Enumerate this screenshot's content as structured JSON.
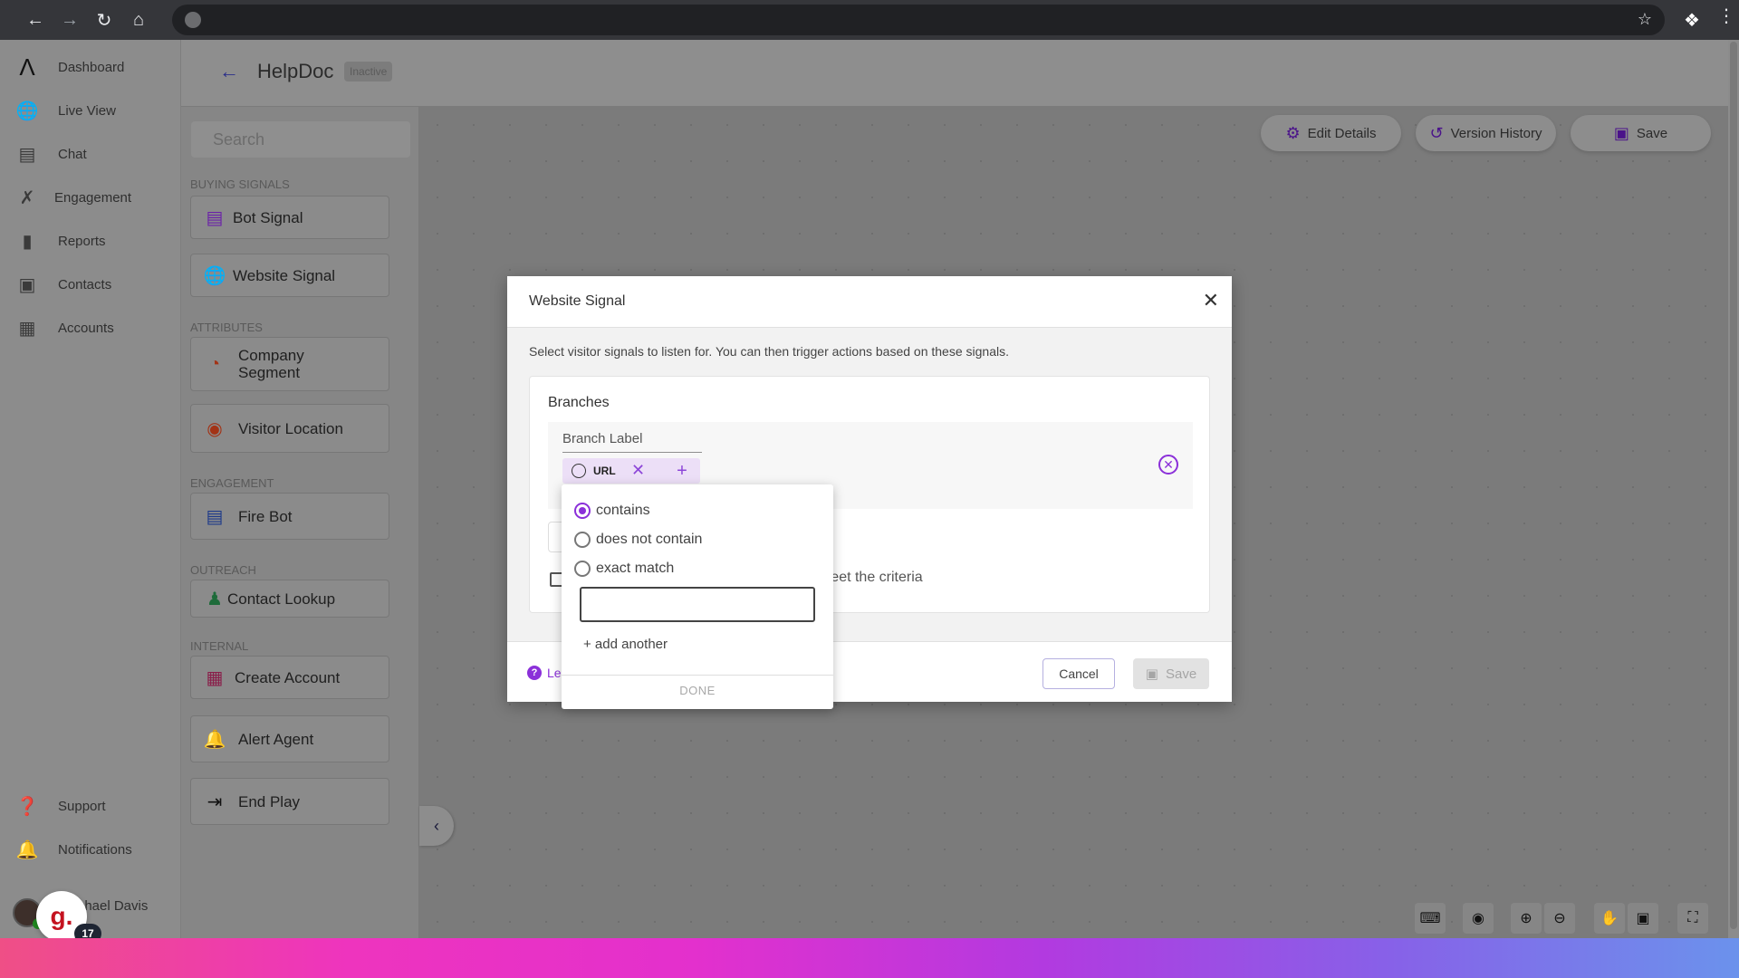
{
  "browser": {
    "back_icon": "arrow-left",
    "forward_icon": "arrow-right",
    "reload_icon": "reload",
    "home_icon": "home",
    "bookmark_icon": "star",
    "extensions_icon": "puzzle",
    "menu_icon": "kebab"
  },
  "nav": {
    "items": [
      {
        "label": "Dashboard",
        "icon": "logo"
      },
      {
        "label": "Live View",
        "icon": "globe-search"
      },
      {
        "label": "Chat",
        "icon": "chat"
      },
      {
        "label": "Engagement",
        "icon": "play-diagram"
      },
      {
        "label": "Reports",
        "icon": "bar-chart"
      },
      {
        "label": "Contacts",
        "icon": "contact-card"
      },
      {
        "label": "Accounts",
        "icon": "building"
      }
    ],
    "bottom": [
      {
        "label": "Support",
        "icon": "question"
      },
      {
        "label": "Notifications",
        "icon": "bell"
      }
    ],
    "user_name": "Michael Davis",
    "widget_letter": "g.",
    "widget_count": "17",
    "collapse_icon": "chevron-left"
  },
  "header": {
    "title": "HelpDoc",
    "status": "Inactive"
  },
  "palette": {
    "search_placeholder": "Search",
    "sections": [
      {
        "title": "BUYING SIGNALS",
        "items": [
          {
            "label": "Bot Signal",
            "icon": "bot-signal",
            "color": "#6b21a8"
          },
          {
            "label": "Website Signal",
            "icon": "website-signal",
            "color": "#6b21a8"
          }
        ]
      },
      {
        "title": "ATTRIBUTES",
        "items": [
          {
            "label": "Company Segment",
            "icon": "pie",
            "color": "#a33316"
          },
          {
            "label": "Visitor Location",
            "icon": "globe",
            "color": "#a33316"
          }
        ]
      },
      {
        "title": "ENGAGEMENT",
        "items": [
          {
            "label": "Fire Bot",
            "icon": "chat",
            "color": "#1e3a8a"
          }
        ]
      },
      {
        "title": "OUTREACH",
        "items": [
          {
            "label": "Contact Lookup",
            "icon": "person-search",
            "color": "#1e6b3a"
          }
        ]
      },
      {
        "title": "INTERNAL",
        "items": [
          {
            "label": "Create Account",
            "icon": "building-plus",
            "color": "#8a1e4a"
          },
          {
            "label": "Alert Agent",
            "icon": "bell",
            "color": "#8a1e4a"
          },
          {
            "label": "End Play",
            "icon": "exit",
            "color": "#111111"
          }
        ]
      }
    ]
  },
  "toolbar": {
    "edit_details": "Edit Details",
    "version_history": "Version History",
    "save": "Save"
  },
  "canvas_controls": [
    "keyboard",
    "fit-view",
    "zoom-in",
    "zoom-out",
    "pan-hand",
    "select-area",
    "fullscreen"
  ],
  "modal": {
    "title": "Website Signal",
    "description": "Select visitor signals to listen for. You can then trigger actions based on these signals.",
    "branches_title": "Branches",
    "branch_label_placeholder": "Branch Label",
    "chip_label": "URL",
    "fallback_label": "Create a branch for visitors who don't meet the criteria",
    "learn_more": "Learn more",
    "cancel": "Cancel",
    "save": "Save"
  },
  "popover": {
    "options": [
      {
        "label": "contains",
        "selected": true
      },
      {
        "label": "does not contain",
        "selected": false
      },
      {
        "label": "exact match",
        "selected": false
      }
    ],
    "input_value": "",
    "add_another": "+ add another",
    "done": "DONE"
  },
  "colors": {
    "accent": "#8b30d9",
    "brand_purple": "#4a128a"
  }
}
